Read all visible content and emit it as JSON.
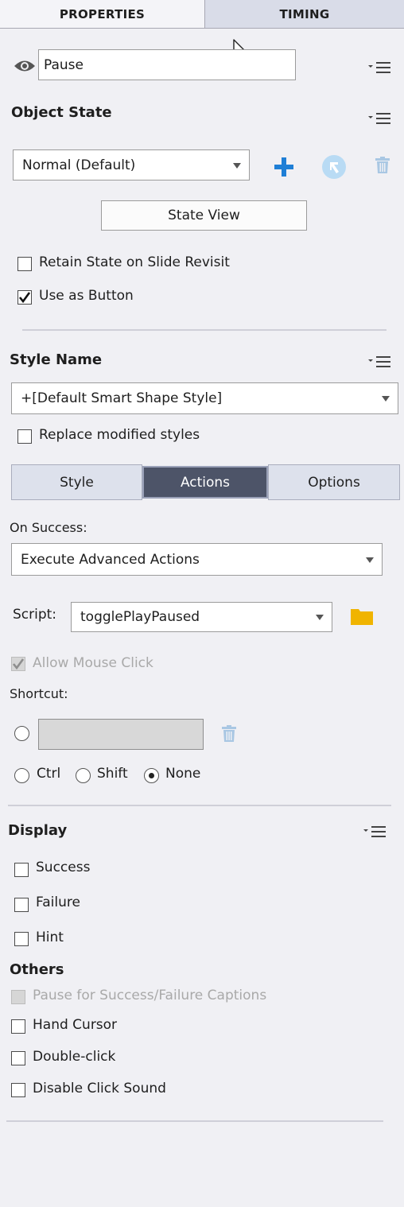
{
  "tabs": [
    {
      "label": "PROPERTIES"
    },
    {
      "label": "TIMING"
    }
  ],
  "name_field": {
    "value": "Pause"
  },
  "object_state": {
    "heading": "Object State",
    "state_select": "Normal (Default)",
    "state_view_button": "State View",
    "retain_state_label": "Retain State on Slide Revisit",
    "use_as_button_label": "Use as Button"
  },
  "style_name": {
    "heading": "Style Name",
    "style_select": "+[Default Smart Shape Style]",
    "replace_label": "Replace modified styles"
  },
  "segments": [
    {
      "label": "Style"
    },
    {
      "label": "Actions"
    },
    {
      "label": "Options"
    }
  ],
  "actions": {
    "on_success_label": "On Success:",
    "on_success_select": "Execute Advanced Actions",
    "script_label": "Script:",
    "script_select": "togglePlayPaused",
    "allow_mouse_click_label": "Allow Mouse Click",
    "shortcut_label": "Shortcut:",
    "modifiers": [
      {
        "label": "Ctrl"
      },
      {
        "label": "Shift"
      },
      {
        "label": "None"
      }
    ]
  },
  "display": {
    "heading": "Display",
    "items": [
      {
        "label": "Success"
      },
      {
        "label": "Failure"
      },
      {
        "label": "Hint"
      }
    ]
  },
  "others": {
    "heading": "Others",
    "pause_label": "Pause for Success/Failure Captions",
    "hand_cursor_label": "Hand Cursor",
    "double_click_label": "Double-click",
    "disable_sound_label": "Disable Click Sound"
  },
  "colors": {
    "accent_blue": "#1f7fd6",
    "folder_yellow": "#f0b400",
    "active_segment": "#4d5468"
  }
}
